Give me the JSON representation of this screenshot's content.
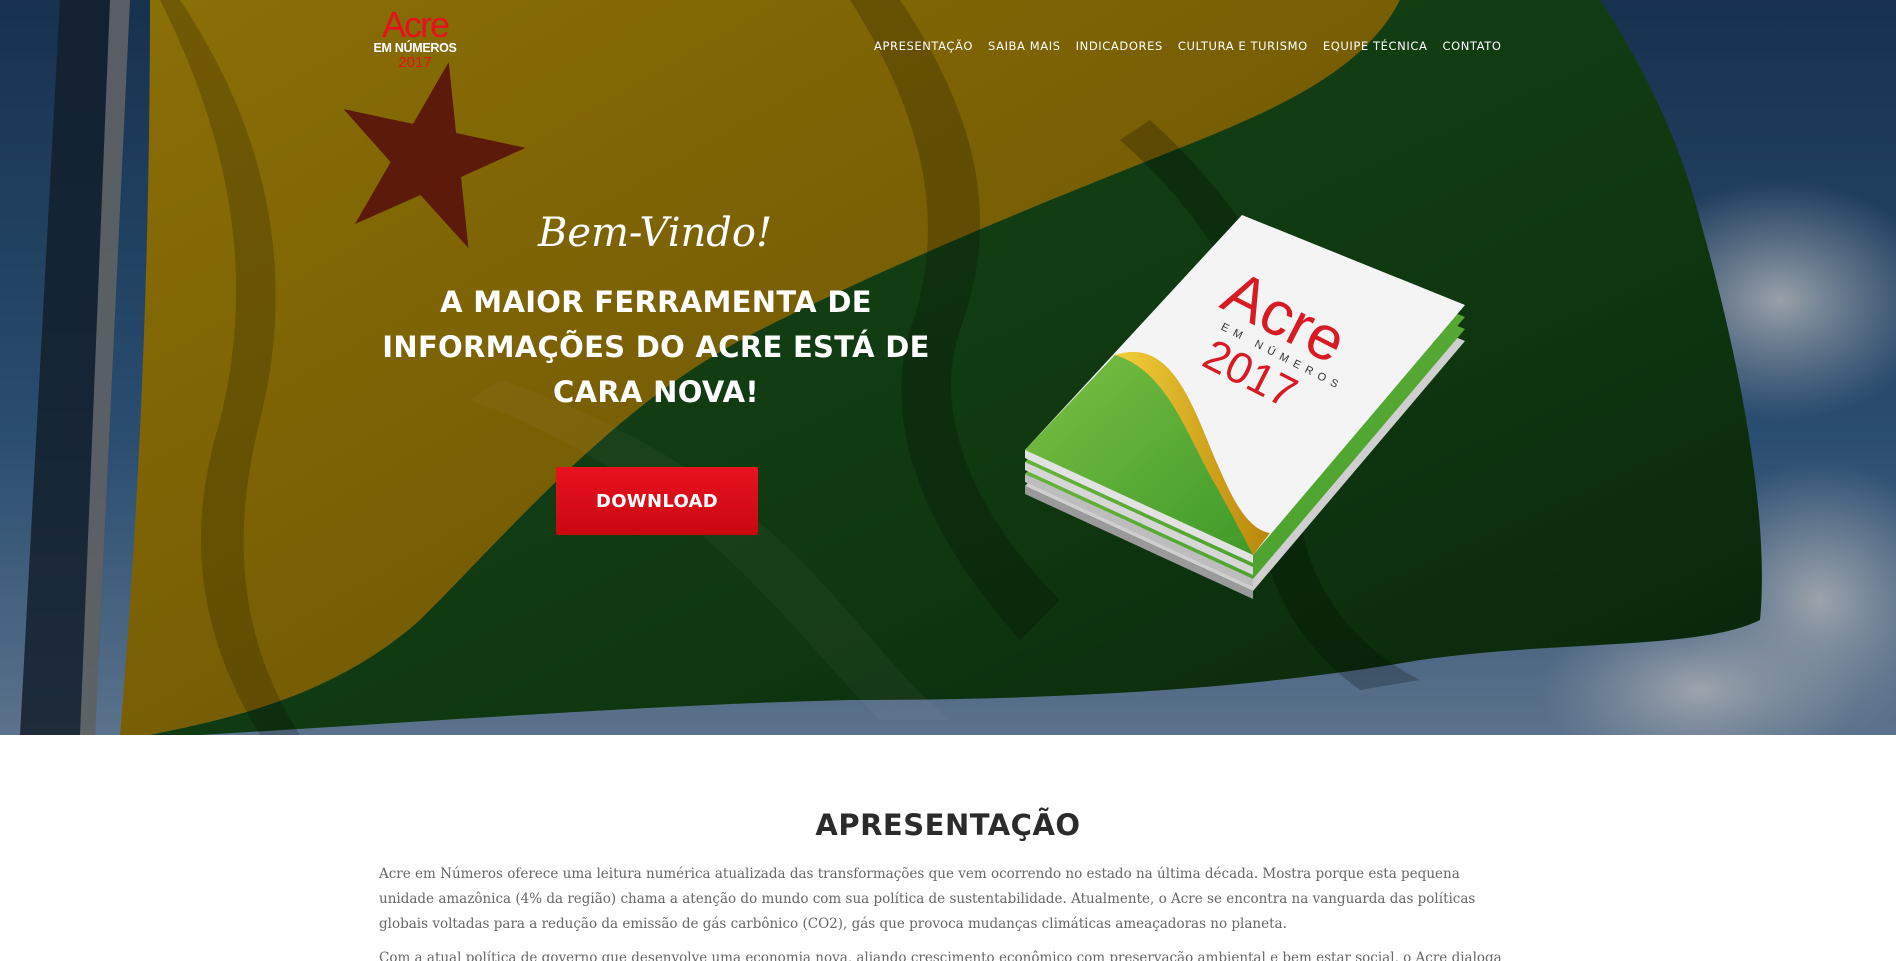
{
  "logo": {
    "line1": "Acre",
    "line2": "EM NÚMEROS",
    "line3": "2017"
  },
  "nav": {
    "items": [
      "APRESENTAÇÃO",
      "SAIBA MAIS",
      "INDICADORES",
      "CULTURA E TURISMO",
      "EQUIPE TÉCNICA",
      "CONTATO"
    ]
  },
  "hero": {
    "welcome": "Bem-Vindo!",
    "headline_line1": "A MAIOR FERRAMENTA DE",
    "headline_line2": "INFORMAÇÕES DO ACRE ESTÁ DE",
    "headline_line3": "CARA NOVA!",
    "download_label": "DOWNLOAD",
    "magazine": {
      "title": "Acre",
      "subtitle": "EM NÚMEROS",
      "year": "2017"
    }
  },
  "apresentacao": {
    "title": "APRESENTAÇÃO",
    "paragraph1": "Acre em Números oferece uma leitura numérica atualizada das transformações que vem ocorrendo no estado na última década. Mostra porque esta pequena unidade amazônica (4% da região) chama a atenção do mundo com sua política de sustentabilidade. Atualmente, o Acre se encontra na vanguarda das políticas globais voltadas para a redução da emissão de gás carbônico (CO2), gás que provoca mudanças climáticas ameaçadoras no planeta.",
    "paragraph2": "Com a atual política de governo que desenvolve uma economia nova, aliando crescimento econômico com preservação ambiental e bem estar social, o Acre dialoga com"
  },
  "colors": {
    "accent": "#e8101c",
    "flag_yellow": "#c9a109",
    "flag_green": "#1d5e1c",
    "sky": "#3d6f9e"
  }
}
